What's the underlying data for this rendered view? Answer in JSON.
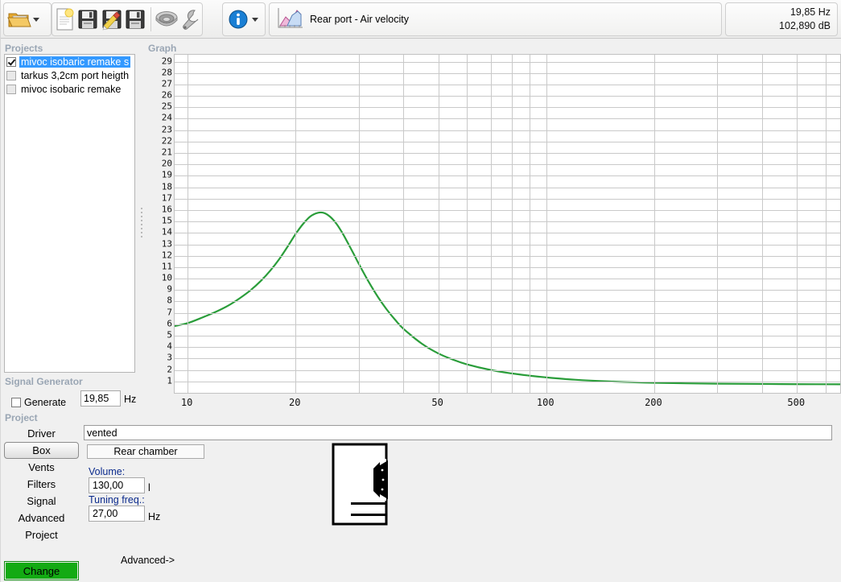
{
  "toolbar": {
    "buttons": [
      {
        "name": "open-project",
        "icon": "folder-open-icon",
        "label": "Open"
      },
      {
        "name": "new-project",
        "icon": "new-document-icon",
        "label": "New"
      },
      {
        "name": "save-project",
        "icon": "floppy-save-icon",
        "label": "Save"
      },
      {
        "name": "save-edit-project",
        "icon": "floppy-edit-icon",
        "label": "Save As"
      },
      {
        "name": "save-copy-project",
        "icon": "floppy-copy-icon",
        "label": "Save Copy"
      },
      {
        "name": "driver-database",
        "icon": "speaker-icon",
        "label": "Drivers"
      },
      {
        "name": "settings",
        "icon": "wrench-icon",
        "label": "Settings"
      },
      {
        "name": "info",
        "icon": "info-icon",
        "label": "Info"
      }
    ],
    "graph_selector": {
      "icon": "chart-icon",
      "label": "Rear port - Air velocity"
    },
    "readout": {
      "frequency": "19,85 Hz",
      "level": "102,890 dB"
    }
  },
  "projects": {
    "caption": "Projects",
    "items": [
      {
        "label": "mivoc isobaric remake s",
        "checked": true,
        "selected": true
      },
      {
        "label": "tarkus 3,2cm port heigth",
        "checked": false,
        "selected": false
      },
      {
        "label": "mivoc isobaric remake",
        "checked": false,
        "selected": false
      }
    ]
  },
  "signal_generator": {
    "caption": "Signal Generator",
    "generate_label": "Generate",
    "generate_checked": false,
    "frequency_value": "19,85",
    "frequency_unit": "Hz"
  },
  "project_nav": {
    "caption": "Project",
    "items": [
      {
        "label": "Driver",
        "active": false
      },
      {
        "label": "Box",
        "active": true
      },
      {
        "label": "Vents",
        "active": false
      },
      {
        "label": "Filters",
        "active": false
      },
      {
        "label": "Signal",
        "active": false
      },
      {
        "label": "Advanced",
        "active": false
      },
      {
        "label": "Project",
        "active": false
      }
    ],
    "change_label": "Change"
  },
  "graph": {
    "caption": "Graph"
  },
  "box_panel": {
    "name_value": "vented",
    "chamber_button": "Rear chamber",
    "volume_label": "Volume:",
    "volume_value": "130,00",
    "volume_unit": "l",
    "tuning_label": "Tuning freq.:",
    "tuning_value": "27,00",
    "tuning_unit": "Hz",
    "advanced_label": "Advanced->",
    "diagram_name": "vented-box-diagram"
  },
  "colors": {
    "curve": "#2a9d3a",
    "selection": "#3399ff",
    "change_button": "#13aa13",
    "grid": "#c9c9c9",
    "label_blue": "#0a2a8c"
  },
  "chart_data": {
    "type": "line",
    "title": "Rear port - Air velocity",
    "xlabel": "",
    "ylabel": "",
    "xscale": "log",
    "xlim": [
      9.2,
      660
    ],
    "ylim": [
      0,
      29.6
    ],
    "xticks": [
      10,
      20,
      50,
      100,
      200,
      500
    ],
    "yticks": [
      1,
      2,
      3,
      4,
      5,
      6,
      7,
      8,
      9,
      10,
      11,
      12,
      13,
      14,
      15,
      16,
      17,
      18,
      19,
      20,
      21,
      22,
      23,
      24,
      25,
      26,
      27,
      28,
      29
    ],
    "grid": true,
    "legend": null,
    "series": [
      {
        "name": "Rear port - Air velocity",
        "color": "#2a9d3a",
        "x": [
          9.2,
          10,
          11,
          12,
          13,
          14,
          15,
          16,
          17,
          18,
          19,
          20,
          21,
          22,
          23,
          24,
          25,
          26,
          27,
          28,
          29,
          30,
          32,
          34,
          36,
          38,
          40,
          45,
          50,
          55,
          60,
          70,
          80,
          90,
          100,
          120,
          150,
          200,
          300,
          400,
          500,
          660
        ],
        "y": [
          5.85,
          6.1,
          6.6,
          7.1,
          7.65,
          8.3,
          9.0,
          9.8,
          10.7,
          11.7,
          12.8,
          13.9,
          14.8,
          15.45,
          15.75,
          15.75,
          15.4,
          14.8,
          14.0,
          13.1,
          12.2,
          11.3,
          9.7,
          8.35,
          7.25,
          6.35,
          5.6,
          4.3,
          3.45,
          2.9,
          2.5,
          2.0,
          1.7,
          1.5,
          1.35,
          1.15,
          1.0,
          0.88,
          0.8,
          0.78,
          0.76,
          0.75
        ]
      }
    ]
  }
}
